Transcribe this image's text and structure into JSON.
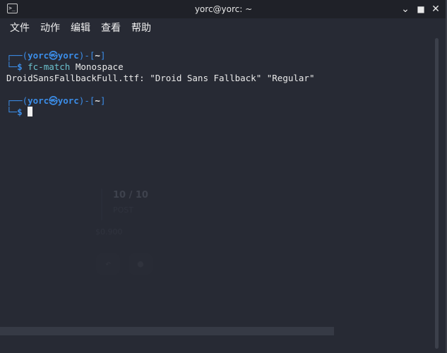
{
  "window": {
    "title": "yorc@yorc: ~",
    "icon": "terminal-icon",
    "minimize_glyph": "⌄",
    "maximize_glyph": "■",
    "close_glyph": "✕"
  },
  "menu": {
    "file": "文件",
    "action": "动作",
    "edit": "编辑",
    "view": "查看",
    "help": "帮助"
  },
  "terminal": {
    "prompt1": {
      "corner": "┌──(",
      "user_host": "yorc㉿yorc",
      "sep": ")-[",
      "dir": "~",
      "close": "]",
      "corner2": "└─",
      "dollar": "$ ",
      "command": "fc-match",
      "argument": " Monospace"
    },
    "output": "DroidSansFallbackFull.ttf: \"Droid Sans Fallback\" \"Regular\"",
    "prompt2": {
      "corner": "┌──(",
      "user_host": "yorc㉿yorc",
      "sep": ")-[",
      "dir": "~",
      "close": "]",
      "corner2": "└─",
      "dollar": "$ "
    }
  },
  "background_ghost": {
    "count": "10 / 10",
    "sub": "POST",
    "amount": "$0.900"
  },
  "colors": {
    "background": "#272a34",
    "titlebar": "#1f2128",
    "prompt_blue": "#3b8de8",
    "command_cyan": "#6cc2ce",
    "text": "#eaeaea"
  }
}
